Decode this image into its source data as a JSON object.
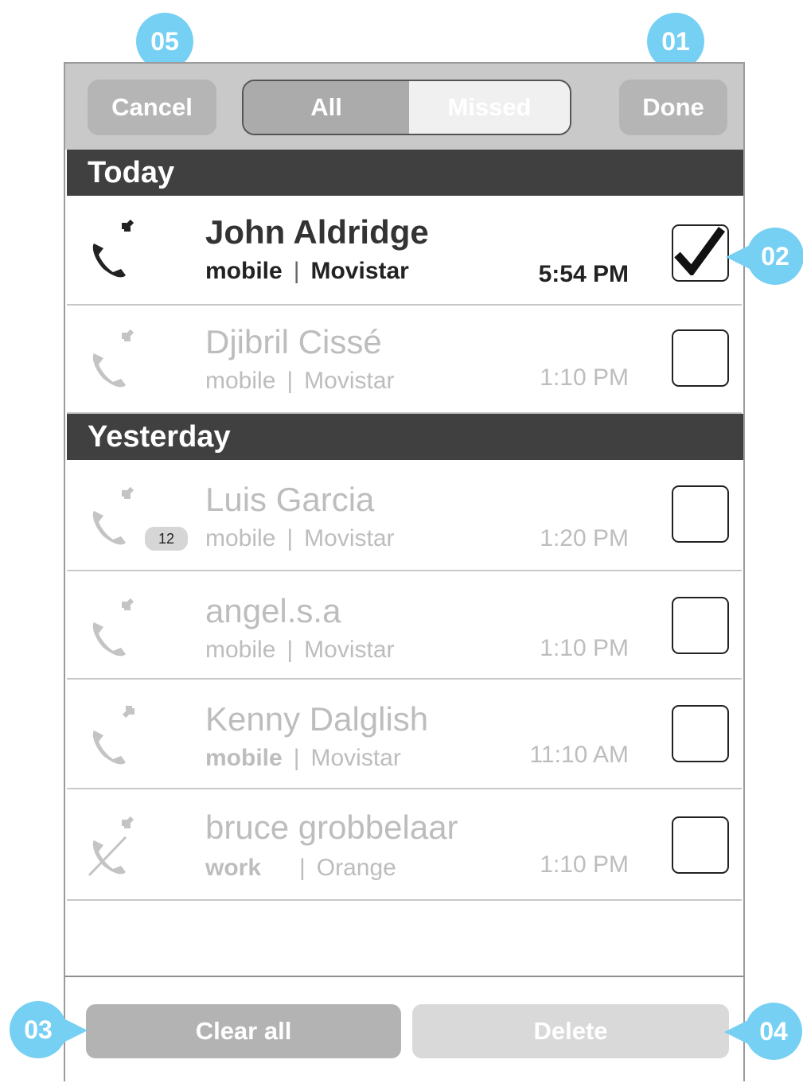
{
  "header": {
    "cancel_label": "Cancel",
    "done_label": "Done",
    "segments": [
      "All",
      "Missed"
    ],
    "selected_segment": "All"
  },
  "sections": [
    {
      "title": "Today",
      "calls": [
        {
          "name": "John Aldridge",
          "type": "mobile",
          "carrier": "Movistar",
          "time": "5:54 PM",
          "direction": "incoming",
          "checked": true,
          "icon": "incoming-call-icon"
        },
        {
          "name": "Djibril Cissé",
          "type": "mobile",
          "carrier": "Movistar",
          "time": "1:10 PM",
          "direction": "incoming",
          "checked": false,
          "icon": "incoming-call-icon"
        }
      ]
    },
    {
      "title": "Yesterday",
      "calls": [
        {
          "name": "Luis Garcia",
          "type": "mobile",
          "carrier": "Movistar",
          "time": "1:20 PM",
          "direction": "incoming",
          "checked": false,
          "count": "12",
          "icon": "incoming-call-icon"
        },
        {
          "name": "angel.s.a",
          "type": "mobile",
          "carrier": "Movistar",
          "time": "1:10 PM",
          "direction": "incoming",
          "checked": false,
          "icon": "incoming-call-icon"
        },
        {
          "name": "Kenny Dalglish",
          "type": "mobile",
          "carrier": "Movistar",
          "time": "11:10 AM",
          "direction": "outgoing",
          "checked": false,
          "icon": "outgoing-call-icon"
        },
        {
          "name": "bruce grobbelaar",
          "type": "work",
          "carrier": "Orange",
          "time": "1:10 PM",
          "direction": "missed",
          "checked": false,
          "icon": "missed-call-icon"
        }
      ]
    }
  ],
  "footer": {
    "clear_label": "Clear all",
    "delete_label": "Delete"
  },
  "callouts": [
    "01",
    "02",
    "03",
    "04",
    "05"
  ],
  "colors": {
    "callout": "#76d0f3",
    "section_header": "#404040",
    "topbar": "#c9c9c9"
  }
}
